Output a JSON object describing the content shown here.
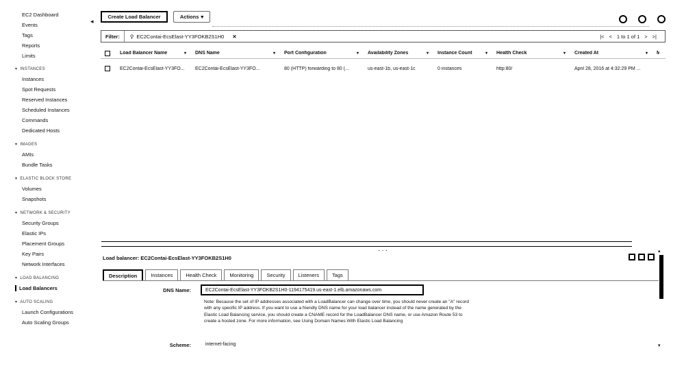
{
  "sidebar": {
    "top_items": [
      "EC2 Dashboard",
      "Events",
      "Tags",
      "Reports",
      "Limits"
    ],
    "sections": [
      {
        "title": "INSTANCES",
        "items": [
          "Instances",
          "Spot Requests",
          "Reserved Instances",
          "Scheduled Instances",
          "Commands",
          "Dedicated Hosts"
        ]
      },
      {
        "title": "IMAGES",
        "items": [
          "AMIs",
          "Bundle Tasks"
        ]
      },
      {
        "title": "ELASTIC BLOCK STORE",
        "items": [
          "Volumes",
          "Snapshots"
        ]
      },
      {
        "title": "NETWORK & SECURITY",
        "items": [
          "Security Groups",
          "Elastic IPs",
          "Placement Groups",
          "Key Pairs",
          "Network Interfaces"
        ]
      },
      {
        "title": "LOAD BALANCING",
        "items": [
          "Load Balancers"
        ]
      },
      {
        "title": "AUTO SCALING",
        "items": [
          "Launch Configurations",
          "Auto Scaling Groups"
        ]
      }
    ],
    "active_item": "Load Balancers"
  },
  "toolbar": {
    "create_label": "Create Load Balancer",
    "actions_label": "Actions"
  },
  "filter": {
    "label": "Filter:",
    "value": "EC2Contai-EcsElast-YY3FOKB2S1H0",
    "remove": "✕",
    "pager": {
      "first": "|<",
      "prev": "<",
      "text": "1 to 1 of 1",
      "next": ">",
      "last": ">|"
    }
  },
  "table": {
    "headers": [
      "Load Balancer Name",
      "DNS Name",
      "Port Configuration",
      "Availability Zones",
      "Instance Count",
      "Health Check",
      "Created At",
      "Mo"
    ],
    "rows": [
      [
        "EC2Contai-EcsElast-YY3FO...",
        "EC2Contai-EcsElast-YY3FO...",
        "80 (HTTP) forwarding to 80 (...",
        "us-east-1b, us-east-1c",
        "0 instances",
        "http:80/",
        "April 28, 2016 at 4:32:29 PM ...",
        ""
      ]
    ]
  },
  "detail": {
    "title": "Load balancer: EC2Contai-EcsElast-YY3FOKB2S1H0",
    "tabs": [
      "Description",
      "Instances",
      "Health Check",
      "Monitoring",
      "Security",
      "Listeners",
      "Tags"
    ],
    "active_tab": "Description",
    "dns_label": "DNS Name:",
    "dns_value": "EC2Contai-EcsElast-YY3FOKB2S1H0-1194175419.us-east-1.elb.amazonaws.com",
    "note": "Note: Because the set of IP addresses associated with a LoadBalancer can change over time, you should never create an \"A\" record with any specific IP address. If you want to use a friendly DNS name for your load balancer instead of the name generated by the Elastic Load Balancing service, you should create a CNAME record for the LoadBalancer DNS name, or use Amazon Route 53 to create a hosted zone. For more information, see Using Domain Names With Elastic Load Balancing",
    "scheme_label": "Scheme:",
    "scheme_value": "internet-facing"
  }
}
